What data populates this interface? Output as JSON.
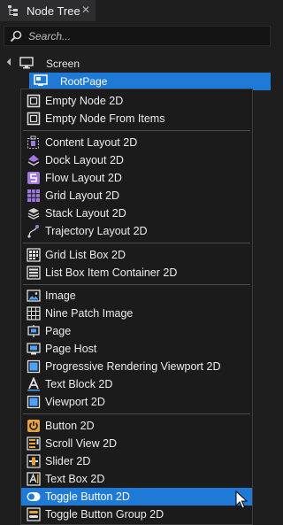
{
  "panel": {
    "tab_title": "Node Tree",
    "close_glyph": "✕"
  },
  "search": {
    "placeholder": "Search..."
  },
  "tree": [
    {
      "label": "Screen",
      "icon": "screen-icon"
    },
    {
      "label": "RootPage",
      "icon": "page-icon",
      "selected": true
    }
  ],
  "menu": {
    "groups": [
      [
        {
          "label": "Empty Node 2D",
          "icon": "empty-node-icon"
        },
        {
          "label": "Empty Node From Items",
          "icon": "empty-node-icon"
        }
      ],
      [
        {
          "label": "Content Layout 2D",
          "icon": "content-layout-icon"
        },
        {
          "label": "Dock Layout 2D",
          "icon": "dock-layout-icon"
        },
        {
          "label": "Flow Layout 2D",
          "icon": "flow-layout-icon"
        },
        {
          "label": "Grid Layout 2D",
          "icon": "grid-layout-icon"
        },
        {
          "label": "Stack Layout 2D",
          "icon": "stack-layout-icon"
        },
        {
          "label": "Trajectory Layout 2D",
          "icon": "trajectory-layout-icon"
        }
      ],
      [
        {
          "label": "Grid List Box 2D",
          "icon": "grid-list-box-icon"
        },
        {
          "label": "List Box Item Container 2D",
          "icon": "list-box-icon"
        }
      ],
      [
        {
          "label": "Image",
          "icon": "image-icon"
        },
        {
          "label": "Nine Patch Image",
          "icon": "nine-patch-icon"
        },
        {
          "label": "Page",
          "icon": "page-icon"
        },
        {
          "label": "Page Host",
          "icon": "page-host-icon"
        },
        {
          "label": "Progressive Rendering Viewport 2D",
          "icon": "viewport-icon"
        },
        {
          "label": "Text Block 2D",
          "icon": "text-block-icon"
        },
        {
          "label": "Viewport 2D",
          "icon": "viewport-icon"
        }
      ],
      [
        {
          "label": "Button 2D",
          "icon": "button-icon"
        },
        {
          "label": "Scroll View 2D",
          "icon": "scroll-view-icon"
        },
        {
          "label": "Slider 2D",
          "icon": "slider-icon"
        },
        {
          "label": "Text Box 2D",
          "icon": "text-box-icon"
        },
        {
          "label": "Toggle Button 2D",
          "icon": "toggle-button-icon",
          "highlighted": true
        },
        {
          "label": "Toggle Button Group 2D",
          "icon": "toggle-button-group-icon"
        }
      ]
    ]
  },
  "colors": {
    "accent": "#1e7ad6",
    "orange": "#e6a23c",
    "purple": "#a078e0",
    "blue": "#4aa3ff"
  }
}
